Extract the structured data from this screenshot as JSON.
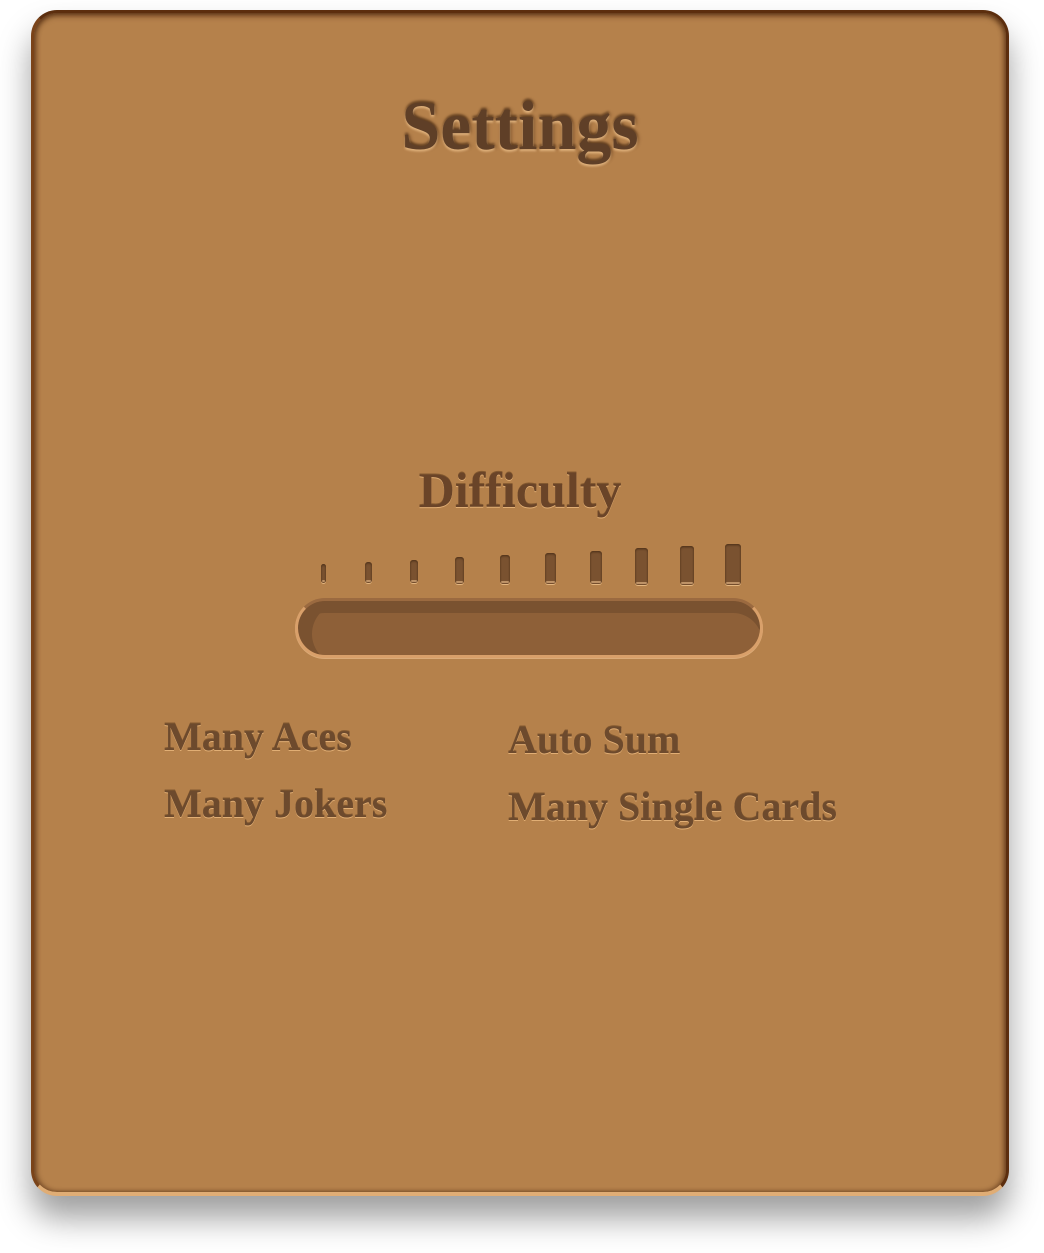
{
  "settings": {
    "title": "Settings",
    "difficulty": {
      "label": "Difficulty",
      "tick_count": 10,
      "level": 0
    },
    "options": [
      {
        "label": "Many Aces"
      },
      {
        "label": "Auto Sum"
      },
      {
        "label": "Many Jokers"
      },
      {
        "label": "Many Single Cards"
      }
    ]
  },
  "colors": {
    "panel": "#b5814b",
    "panel_border": "#5c2e0e",
    "text": "#6d4a2d",
    "track": "#8e6038"
  }
}
